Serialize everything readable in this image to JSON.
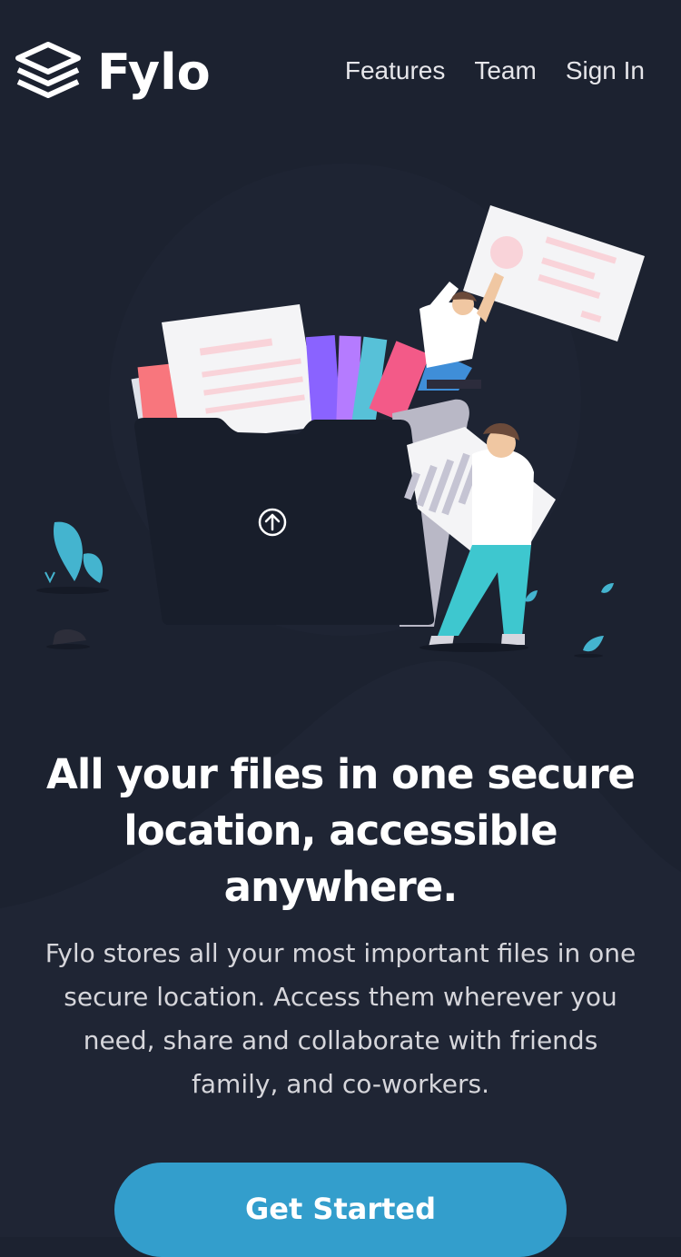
{
  "brand": {
    "name": "Fylo",
    "logo_icon": "layers-icon"
  },
  "nav": {
    "items": [
      {
        "label": "Features"
      },
      {
        "label": "Team"
      },
      {
        "label": "Sign In"
      }
    ]
  },
  "hero": {
    "title": "All your files in one secure location, accessible anywhere.",
    "description": "Fylo stores all your most important files in one secure location. Access them wherever you need, share and collaborate with friends family, and co-workers.",
    "cta_label": "Get Started",
    "upload_icon": "upload-arrow-icon"
  },
  "colors": {
    "background": "#1c2230",
    "accent": "#339ecc",
    "folder": "#181e2b"
  }
}
